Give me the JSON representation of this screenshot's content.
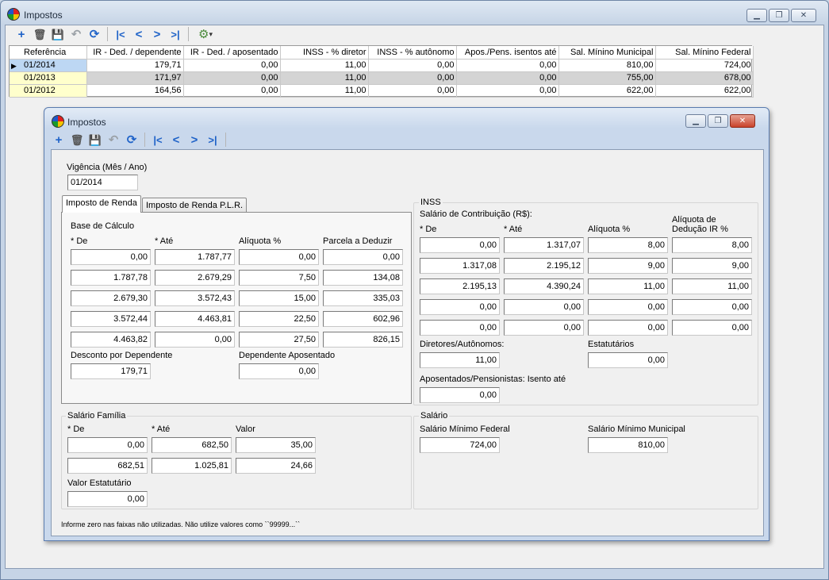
{
  "main_window": {
    "title": "Impostos"
  },
  "toolbar": {
    "add": "+",
    "delete": "🗑",
    "save": "💾",
    "undo": "↶",
    "refresh": "⟳",
    "first": "|<",
    "prev": "<",
    "next": ">",
    "last": ">|",
    "tools": "⚙",
    "tools_arrow": "▾"
  },
  "grid": {
    "columns": [
      "Referência",
      "IR - Ded. / dependente",
      "IR - Ded. / aposentado",
      "INSS - % diretor",
      "INSS - % autônomo",
      "Apos./Pens. isentos até",
      "Sal. Mínino Municipal",
      "Sal. Mínino Federal"
    ],
    "rows": [
      [
        "01/2014",
        "179,71",
        "0,00",
        "11,00",
        "0,00",
        "0,00",
        "810,00",
        "724,00"
      ],
      [
        "01/2013",
        "171,97",
        "0,00",
        "11,00",
        "0,00",
        "0,00",
        "755,00",
        "678,00"
      ],
      [
        "01/2012",
        "164,56",
        "0,00",
        "11,00",
        "0,00",
        "0,00",
        "622,00",
        "622,00"
      ]
    ]
  },
  "detail_window": {
    "title": "Impostos",
    "vigencia_label": "Vigência  (Mês / Ano)",
    "vigencia_value": "01/2014",
    "tabs": [
      "Imposto de Renda",
      "Imposto de Renda P.L.R."
    ],
    "ir": {
      "base_label": "Base de Cálculo",
      "headers": [
        "* De",
        "* Até",
        "Alíquota %",
        "Parcela a Deduzir"
      ],
      "rows": [
        [
          "0,00",
          "1.787,77",
          "0,00",
          "0,00"
        ],
        [
          "1.787,78",
          "2.679,29",
          "7,50",
          "134,08"
        ],
        [
          "2.679,30",
          "3.572,43",
          "15,00",
          "335,03"
        ],
        [
          "3.572,44",
          "4.463,81",
          "22,50",
          "602,96"
        ],
        [
          "4.463,82",
          "0,00",
          "27,50",
          "826,15"
        ]
      ],
      "desconto_label": "Desconto por Dependente",
      "desconto_value": "179,71",
      "aposentado_label": "Dependente Aposentado",
      "aposentado_value": "0,00"
    },
    "inss": {
      "group_label": "INSS",
      "salario_label": "Salário de Contribuição (R$):",
      "headers": [
        "* De",
        "* Até",
        "Alíquota %",
        "Alíquota de",
        "Dedução IR %"
      ],
      "rows": [
        [
          "0,00",
          "1.317,07",
          "8,00",
          "8,00"
        ],
        [
          "1.317,08",
          "2.195,12",
          "9,00",
          "9,00"
        ],
        [
          "2.195,13",
          "4.390,24",
          "11,00",
          "11,00"
        ],
        [
          "0,00",
          "0,00",
          "0,00",
          "0,00"
        ],
        [
          "0,00",
          "0,00",
          "0,00",
          "0,00"
        ]
      ],
      "diretores_label": "Diretores/Autônomos:",
      "diretores_value": "11,00",
      "estatutarios_label": "Estatutários",
      "estatutarios_value": "0,00",
      "aposentados_label": "Aposentados/Pensionistas: Isento até",
      "aposentados_value": "0,00"
    },
    "familia": {
      "group_label": "Salário Família",
      "headers": [
        "* De",
        "* Até",
        "Valor"
      ],
      "rows": [
        [
          "0,00",
          "682,50",
          "35,00"
        ],
        [
          "682,51",
          "1.025,81",
          "24,66"
        ]
      ],
      "estatutario_label": "Valor Estatutário",
      "estatutario_value": "0,00"
    },
    "salario": {
      "group_label": "Salário",
      "federal_label": "Salário Mínimo Federal",
      "federal_value": "724,00",
      "municipal_label": "Salário Mínimo Municipal",
      "municipal_value": "810,00"
    },
    "footer_note": "Informe zero nas faixas não utilizadas. Não utilize valores como ``99999...``"
  }
}
